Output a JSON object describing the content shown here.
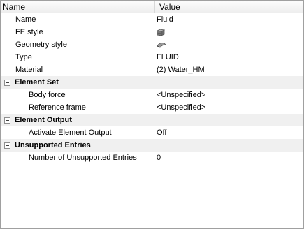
{
  "header": {
    "name_label": "Name",
    "value_label": "Value"
  },
  "properties": {
    "name": {
      "label": "Name",
      "value": "Fluid"
    },
    "fe_style": {
      "label": "FE style",
      "icon": "cube-icon"
    },
    "geometry_style": {
      "label": "Geometry style",
      "icon": "shape-icon"
    },
    "type": {
      "label": "Type",
      "value": "FLUID"
    },
    "material": {
      "label": "Material",
      "value": "(2) Water_HM"
    }
  },
  "groups": {
    "element_set": {
      "label": "Element Set",
      "items": {
        "body_force": {
          "label": "Body force",
          "value": "<Unspecified>"
        },
        "reference_frame": {
          "label": "Reference frame",
          "value": "<Unspecified>"
        }
      }
    },
    "element_output": {
      "label": "Element Output",
      "items": {
        "activate_element_output": {
          "label": "Activate Element Output",
          "value": "Off"
        }
      }
    },
    "unsupported_entries": {
      "label": "Unsupported Entries",
      "items": {
        "number_of_unsupported_entries": {
          "label": "Number of Unsupported Entries",
          "value": "0"
        }
      }
    }
  }
}
